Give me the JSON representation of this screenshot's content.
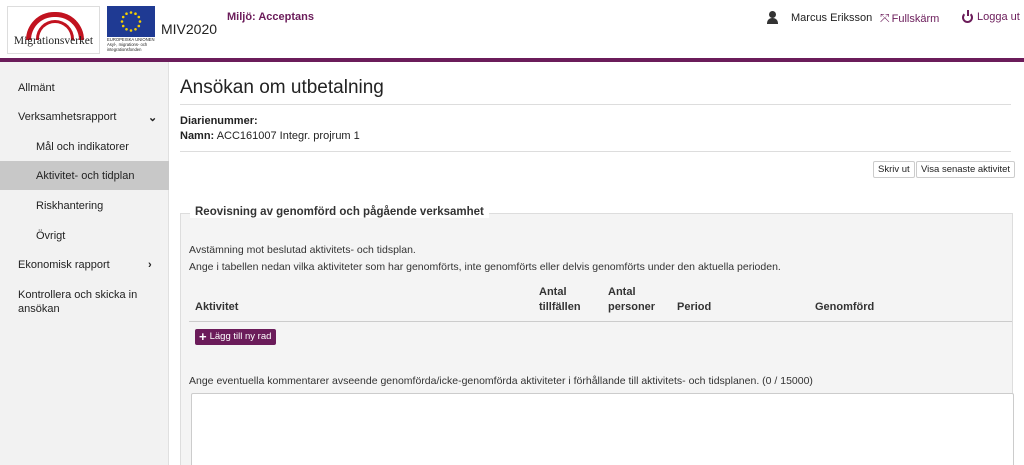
{
  "header": {
    "logo_text": "Migrationsverket",
    "eu_text": "EUROPEISKA UNIONEN Asyl-, migrations- och integrationsfonden",
    "app_title": "MIV2020",
    "environment": "Miljö: Acceptans",
    "user_name": "Marcus Eriksson",
    "fullscreen_label": "Fullskärm",
    "logout_label": "Logga ut",
    "brand_color": "#6b1c5a"
  },
  "sidebar": {
    "items": [
      {
        "label": "Allmänt",
        "level": 0,
        "active": false
      },
      {
        "label": "Verksamhetsrapport",
        "level": 0,
        "active": false,
        "chevron": "chevron-down-icon"
      },
      {
        "label": "Mål och indikatorer",
        "level": 1,
        "active": false
      },
      {
        "label": "Aktivitet- och tidplan",
        "level": 1,
        "active": true
      },
      {
        "label": "Riskhantering",
        "level": 1,
        "active": false
      },
      {
        "label": "Övrigt",
        "level": 1,
        "active": false
      },
      {
        "label": "Ekonomisk rapport",
        "level": 0,
        "active": false,
        "chevron": "chevron-right-icon"
      },
      {
        "label": "Kontrollera och skicka in",
        "label2": "ansökan",
        "level": 0,
        "active": false
      }
    ]
  },
  "main": {
    "title": "Ansökan om utbetalning",
    "diarienummer_label": "Diarienummer:",
    "namn_label": "Namn:",
    "namn_value": "ACC161007 Integr. projrum 1",
    "print_button": "Skriv ut",
    "latest_activity_button": "Visa senaste aktivitet",
    "section_legend": "Reovisning av genomförd och pågående verksamhet",
    "description_1": "Avstämning mot beslutad aktivitets- och tidsplan.",
    "description_2": "Ange i tabellen nedan vilka aktiviteter som har genomförts, inte genomförts eller delvis genomförts under den aktuella perioden.",
    "table_headers": {
      "aktivitet": "Aktivitet",
      "antal_tillfallen_1": "Antal",
      "antal_tillfallen_2": "tillfällen",
      "antal_personer_1": "Antal",
      "antal_personer_2": "personer",
      "period": "Period",
      "genomford": "Genomförd"
    },
    "add_row_button": "Lägg till ny rad",
    "comment_label": "Ange eventuella kommentarer avseende genomförda/icke-genomförda aktiviteter i förhållande till aktivitets- och tidsplanen. (0 / 15000)",
    "comment_value": ""
  }
}
